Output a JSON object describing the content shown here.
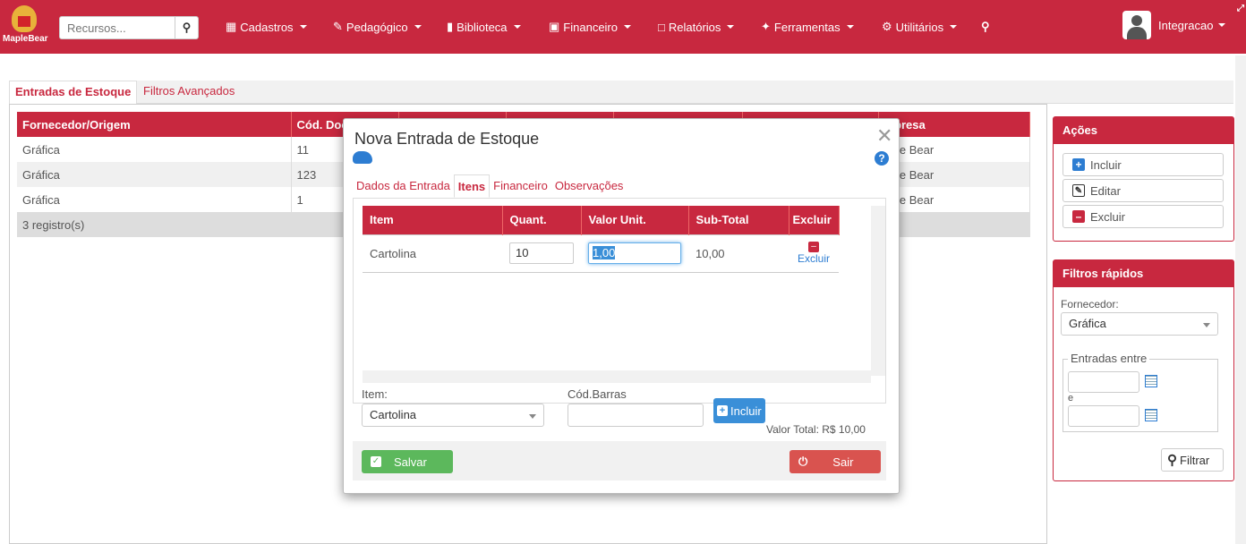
{
  "nav": {
    "logo_text": "MapleBear",
    "search_placeholder": "Recursos...",
    "menu": [
      "Cadastros",
      "Pedagógico",
      "Biblioteca",
      "Financeiro",
      "Relatórios",
      "Ferramentas",
      "Utilitários"
    ],
    "user": "Integracao"
  },
  "tabs": [
    "Entradas de Estoque",
    "Filtros Avançados"
  ],
  "grid": {
    "headers": [
      "Fornecedor/Origem",
      "Cód. Doc",
      "",
      "",
      "",
      "",
      "mpresa"
    ],
    "rows": [
      [
        "Gráfica",
        "11",
        "aple Bear"
      ],
      [
        "Gráfica",
        "123",
        "aple Bear"
      ],
      [
        "Gráfica",
        "1",
        "aple Bear"
      ]
    ],
    "footer": "3 registro(s)"
  },
  "acoes": {
    "title": "Ações",
    "incluir": "Incluir",
    "editar": "Editar",
    "excluir": "Excluir"
  },
  "filtros": {
    "title": "Filtros rápidos",
    "fornecedor_label": "Fornecedor:",
    "fornecedor_value": "Gráfica",
    "entradas_label": "Entradas entre",
    "e_label": "e",
    "filtrar": "Filtrar"
  },
  "modal": {
    "title": "Nova Entrada de Estoque",
    "tabs": [
      "Dados da Entrada",
      "Itens",
      "Financeiro",
      "Observações"
    ],
    "headers": [
      "Item",
      "Quant.",
      "Valor Unit.",
      "Sub-Total",
      "Excluir"
    ],
    "row": {
      "item": "Cartolina",
      "quant": "10",
      "valor": "1,00",
      "subtotal": "10,00",
      "excluir": "Excluir"
    },
    "item_label": "Item:",
    "item_value": "Cartolina",
    "barras_label": "Cód.Barras",
    "incluir": "Incluir",
    "valor_total": "Valor Total: R$  10,00",
    "salvar": "Salvar",
    "sair": "Sair"
  }
}
